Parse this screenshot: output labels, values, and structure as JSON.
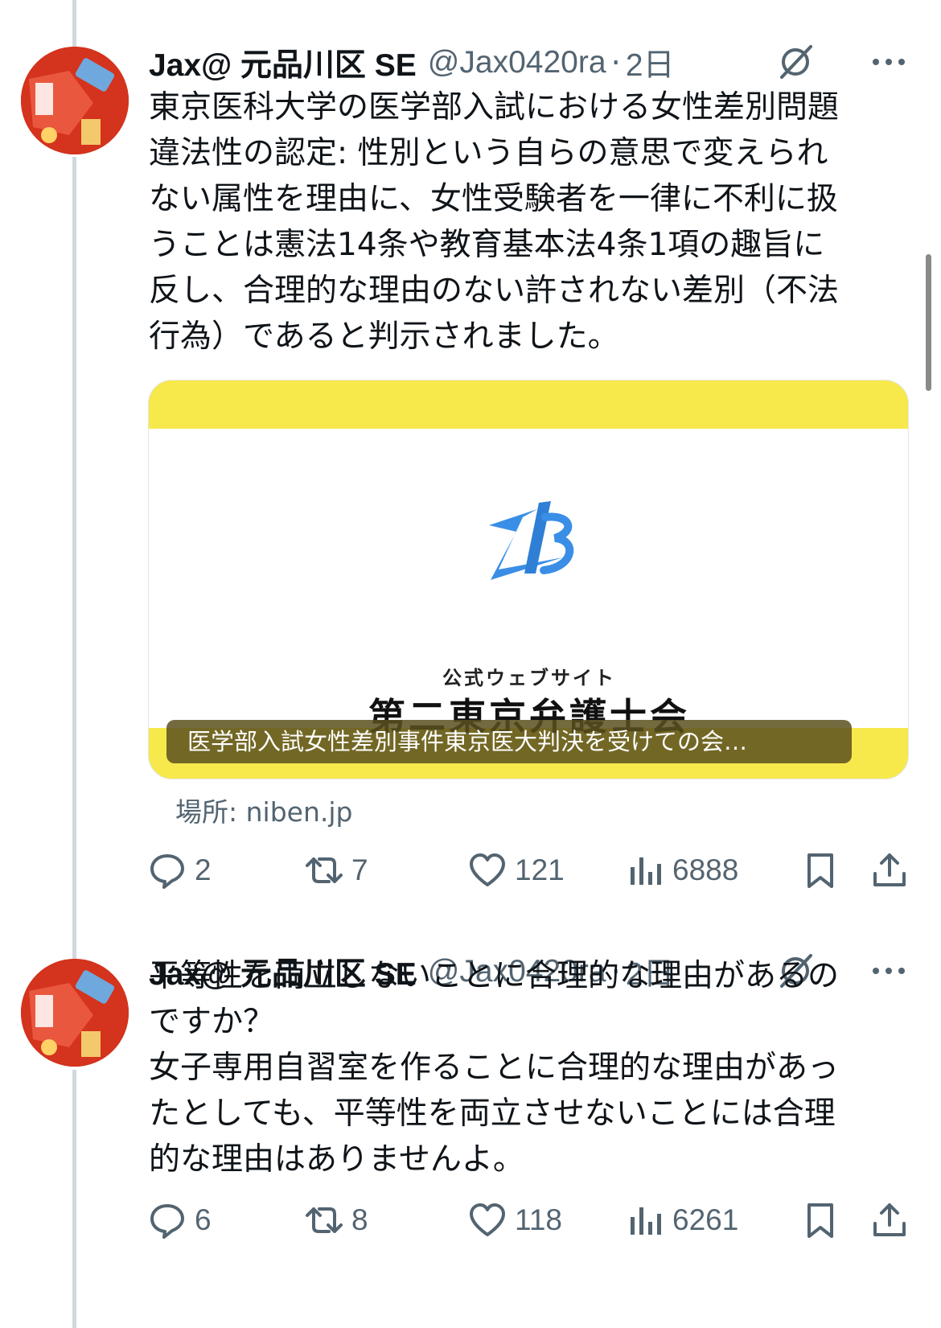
{
  "tweets": [
    {
      "display_name": "Jax@ 元品川区 SE",
      "handle": "@Jax0420ra",
      "separator": "·",
      "time": "2日",
      "text": "東京医科大学の医学部入試における女性差別問題\n違法性の認定: 性別という自らの意思で変えられ\nない属性を理由に、女性受験者を一律に不利に扱\nうことは憲法14条や教育基本法4条1項の趣旨に\n反し、合理的な理由のない許されない差別（不法\n行為）であると判示されました。",
      "card": {
        "subtitle": "公式ウェブサイト",
        "title": "第二東京弁護士会",
        "caption": "医学部入試女性差別事件東京医大判決を受けての会…",
        "source": "場所: niben.jp"
      },
      "stats": {
        "replies": "2",
        "retweets": "7",
        "likes": "121",
        "views": "6888"
      }
    },
    {
      "display_name": "Jax@ 元品川区 SE",
      "handle": "@Jax0420ra",
      "separator": "·",
      "time": "2日",
      "text": "平等性を両立しないことに合理的な理由があるの\nですか？\n女子専用自習室を作ることに合理的な理由があっ\nたとしても、平等性を両立させないことには合理\n的な理由はありませんよ。",
      "stats": {
        "replies": "6",
        "retweets": "8",
        "likes": "118",
        "views": "6261"
      }
    }
  ],
  "icons": {
    "grok": "grok-icon",
    "more": "more-icon",
    "reply": "reply-icon",
    "retweet": "retweet-icon",
    "like": "heart-icon",
    "views": "views-icon",
    "bookmark": "bookmark-icon",
    "share": "share-icon"
  },
  "colors": {
    "text": "#0f1419",
    "secondary": "#536471",
    "thread_line": "#cfd9de",
    "card_yellow": "#f7e84c",
    "logo_blue": "#3a8ee6"
  }
}
